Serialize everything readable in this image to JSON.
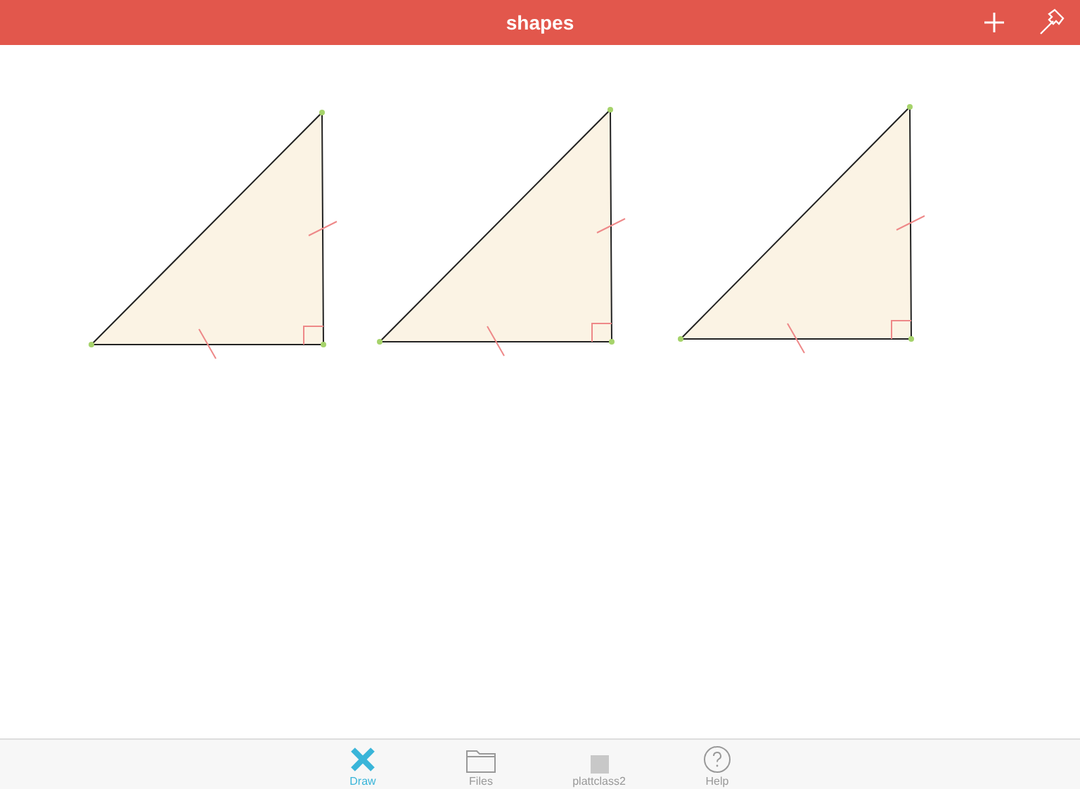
{
  "header": {
    "title": "shapes"
  },
  "tabs": [
    {
      "label": "Draw",
      "kind": "draw",
      "selected": true
    },
    {
      "label": "Files",
      "kind": "files",
      "selected": false
    },
    {
      "label": "plattclass2",
      "kind": "square",
      "selected": false
    },
    {
      "label": "Help",
      "kind": "help",
      "selected": false
    }
  ]
}
